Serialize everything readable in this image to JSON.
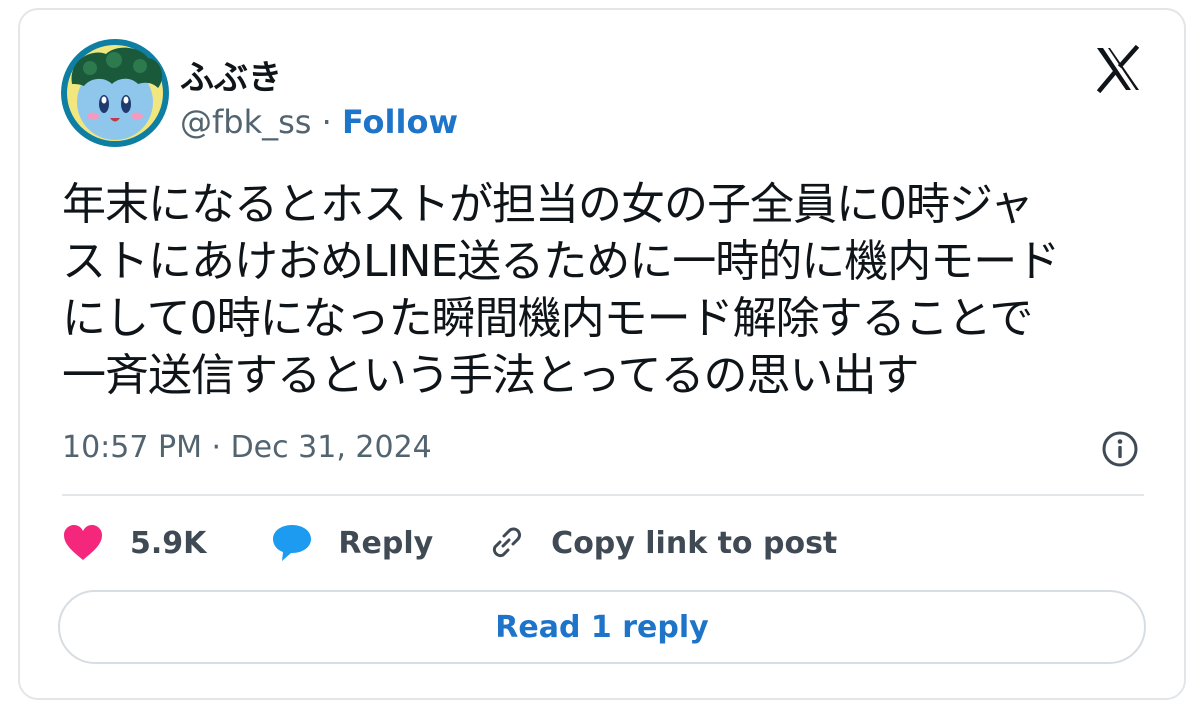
{
  "tweet": {
    "author_name": "ふぶき",
    "handle": "@fbk_ss",
    "separator": "·",
    "follow_label": "Follow",
    "text_lines": [
      "年末になるとホストが担当の女の子全員に0時ジャ",
      "ストにあけおめLINE送るために一時的に機内モード",
      "にして0時になった瞬間機内モード解除することで",
      "一斉送信するという手法とってるの思い出す"
    ],
    "timestamp": "10:57 PM · Dec 31, 2024",
    "likes_count": "5.9K",
    "reply_label": "Reply",
    "copy_link_label": "Copy link to post",
    "read_replies_label": "Read 1 reply"
  },
  "colors": {
    "accent": "#1d74c8",
    "like": "#f4277c",
    "reply_bubble": "#1d9bf0",
    "text_primary": "#0f1419",
    "text_secondary": "#536471"
  },
  "icons": [
    "x-logo-icon",
    "info-icon",
    "heart-icon",
    "speech-bubble-icon",
    "link-icon"
  ]
}
